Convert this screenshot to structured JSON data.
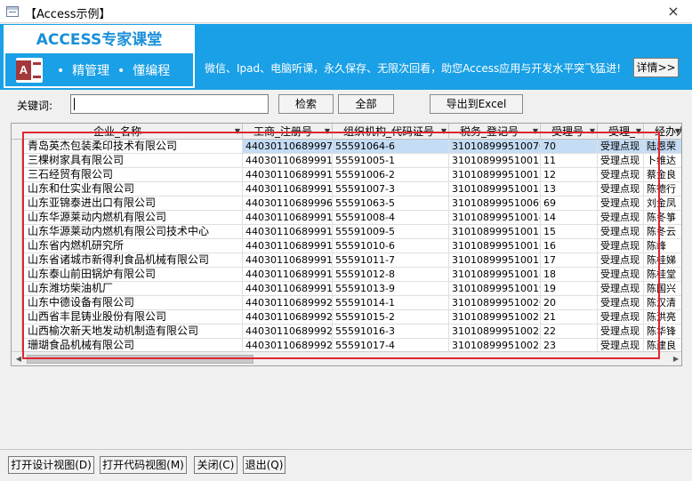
{
  "window": {
    "title": "【Access示例】",
    "close_glyph": "×"
  },
  "banner": {
    "brand": "ACCESS专家课堂",
    "logo_letter": "A",
    "slogan": "•  精管理  •  懂编程",
    "text": "微信、Ipad、电脑听课，永久保存、无限次回看，助您Access应用与开发水平突飞猛进!",
    "details_button": "详情>>"
  },
  "search": {
    "label": "关键词:",
    "value": "",
    "search_button": "检索",
    "all_button": "全部",
    "export_button": "导出到Excel"
  },
  "grid": {
    "columns": [
      "企业_名称",
      "工商_注册号",
      "组织机构_代码证号",
      "税务_登记号",
      "受理号",
      "受理_",
      "经办人"
    ],
    "rows": [
      [
        "青岛英杰包装柔印技术有限公司",
        "440301106899970",
        "55591064-6",
        "310108999510070",
        "70",
        "受理点现",
        "陆恩荣"
      ],
      [
        "三棵树家具有限公司",
        "440301106899911",
        "55591005-1",
        "310108999510011",
        "11",
        "受理点现",
        "卜维达"
      ],
      [
        "三石经贸有限公司",
        "440301106899912",
        "55591006-2",
        "310108999510012",
        "12",
        "受理点现",
        "蔡金良"
      ],
      [
        "山东和仕实业有限公司",
        "440301106899913",
        "55591007-3",
        "310108999510013",
        "13",
        "受理点现",
        "陈德行"
      ],
      [
        "山东亚锦泰进出口有限公司",
        "440301106899969",
        "55591063-5",
        "310108999510069",
        "69",
        "受理点现",
        "刘金凤"
      ],
      [
        "山东华源莱动内燃机有限公司",
        "440301106899914",
        "55591008-4",
        "310108999510014",
        "14",
        "受理点现",
        "陈冬箏"
      ],
      [
        "山东华源莱动内燃机有限公司技术中心",
        "440301106899915",
        "55591009-5",
        "310108999510015",
        "15",
        "受理点现",
        "陈冬云"
      ],
      [
        "山东省内燃机研究所",
        "440301106899916",
        "55591010-6",
        "310108999510016",
        "16",
        "受理点现",
        "陈峰"
      ],
      [
        "山东省诸城市新得利食品机械有限公司",
        "440301106899917",
        "55591011-7",
        "310108999510017",
        "17",
        "受理点现",
        "陈桂娣"
      ],
      [
        "山东泰山前田锅炉有限公司",
        "440301106899918",
        "55591012-8",
        "310108999510018",
        "18",
        "受理点现",
        "陈桂堂"
      ],
      [
        "山东潍坊柴油机厂",
        "440301106899919",
        "55591013-9",
        "310108999510019",
        "19",
        "受理点现",
        "陈国兴"
      ],
      [
        "山东中德设备有限公司",
        "440301106899920",
        "55591014-1",
        "310108999510020",
        "20",
        "受理点现",
        "陈汉清"
      ],
      [
        "山西省丰昆铸业股份有限公司",
        "440301106899921",
        "55591015-2",
        "310108999510021",
        "21",
        "受理点现",
        "陈洪亮"
      ],
      [
        "山西榆次新天地发动机制造有限公司",
        "440301106899922",
        "55591016-3",
        "310108999510022",
        "22",
        "受理点现",
        "陈华锋"
      ],
      [
        "珊瑚食品机械有限公司",
        "440301106899923",
        "55591017-4",
        "310108999510023",
        "23",
        "受理点现",
        "陈建良"
      ]
    ]
  },
  "buttons": {
    "design_view": "打开设计视图(D)",
    "code_view": "打开代码视图(M)",
    "close": "关闭(C)",
    "exit": "退出(Q)"
  }
}
